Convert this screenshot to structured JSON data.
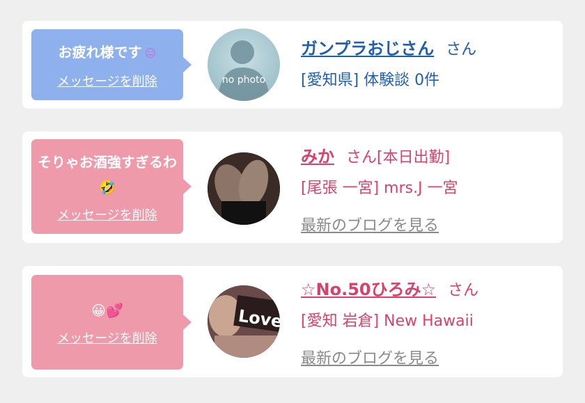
{
  "colors": {
    "blue_bubble": "#8eb0ed",
    "pink_bubble": "#ee9aaa",
    "blue_text": "#1f5fae",
    "pink_text": "#d9416a",
    "gray_link": "#8a8a8a",
    "background": "#efefef"
  },
  "cards": [
    {
      "bubble": {
        "message": "お疲れ様です",
        "emoji": "😑",
        "delete": "メッセージを削除"
      },
      "avatar": {
        "icon": "no-photo-icon",
        "text": "no photo"
      },
      "name": "ガンプラおじさん",
      "suffix": " さん",
      "detail": "[愛知県] 体験談 0件"
    },
    {
      "bubble": {
        "message": "そりゃお酒強すぎるわ",
        "emoji": "🤣",
        "delete": "メッセージを削除"
      },
      "avatar": {
        "icon": "profile-photo"
      },
      "name": "みか",
      "suffix": " さん[本日出勤]",
      "detail": "[尾張 一宮] mrs.J 一宮",
      "blog": "最新のブログを見る"
    },
    {
      "bubble": {
        "message": "",
        "emoji": "😀💕",
        "delete": "メッセージを削除"
      },
      "avatar": {
        "icon": "profile-photo",
        "text": "Love"
      },
      "name": "☆No.50ひろみ☆",
      "suffix": " さん",
      "detail": "[愛知 岩倉] New Hawaii",
      "blog": "最新のブログを見る"
    }
  ]
}
